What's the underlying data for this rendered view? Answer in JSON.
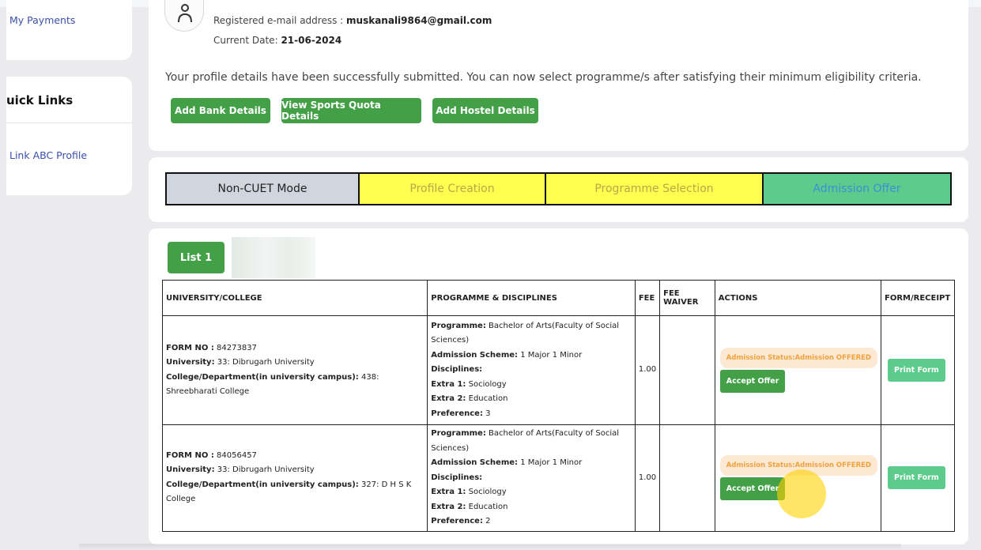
{
  "sidebar": {
    "my_payments": "My Payments",
    "quick_links_title": "uick Links",
    "link_abc_profile": "Link ABC Profile"
  },
  "profile": {
    "email_label": "Registered e-mail address :",
    "email_value": "muskanali9864@gmail.com",
    "date_label": "Current Date:",
    "date_value": "21-06-2024",
    "success_message": "Your profile details have been successfully submitted. You can now select programme/s after satisfying their minimum eligibility criteria."
  },
  "actions": {
    "add_bank": "Add Bank Details",
    "view_sports": "View Sports Quota Details",
    "add_hostel": "Add Hostel Details"
  },
  "stepper": [
    "Non-CUET Mode",
    "Profile Creation",
    "Programme Selection",
    "Admission Offer"
  ],
  "list_tab": "List 1",
  "table": {
    "headers": [
      "UNIVERSITY/COLLEGE",
      "PROGRAMME & DISCIPLINES",
      "FEE",
      "FEE WAIVER",
      "ACTIONS",
      "FORM/RECEIPT"
    ],
    "labels": {
      "form_no": "FORM NO :",
      "university": "University:",
      "college": "College/Department(in university campus):",
      "programme": "Programme:",
      "admission_scheme": "Admission Scheme:",
      "disciplines": "Disciplines:",
      "extra1": "Extra 1:",
      "extra2": "Extra 2:",
      "preference": "Preference:"
    },
    "rows": [
      {
        "form_no": "84273837",
        "university": "33: Dibrugarh University",
        "college": "438: Shreebharati College",
        "programme": "Bachelor of Arts(Faculty of Social Sciences)",
        "admission_scheme": "1 Major 1 Minor",
        "extra1": "Sociology",
        "extra2": "Education",
        "preference": "3",
        "fee": "1.00",
        "fee_waiver": "",
        "status": "Admission Status:Admission OFFERED",
        "accept": "Accept Offer",
        "print": "Print Form"
      },
      {
        "form_no": "84056457",
        "university": "33: Dibrugarh University",
        "college": "327: D H S K College",
        "programme": "Bachelor of Arts(Faculty of Social Sciences)",
        "admission_scheme": "1 Major 1 Minor",
        "extra1": "Sociology",
        "extra2": "Education",
        "preference": "2",
        "fee": "1.00",
        "fee_waiver": "",
        "status": "Admission Status:Admission OFFERED",
        "accept": "Accept Offer",
        "print": "Print Form"
      }
    ]
  },
  "icons": {
    "avatar": "user-icon"
  },
  "colors": {
    "primary_green": "#43a047",
    "light_green": "#5dcb8c",
    "yellow_step": "#ffff4f",
    "gray_step": "#d1d5de",
    "status_orange": "#f0a33c",
    "link_blue": "#3a4fa8"
  }
}
